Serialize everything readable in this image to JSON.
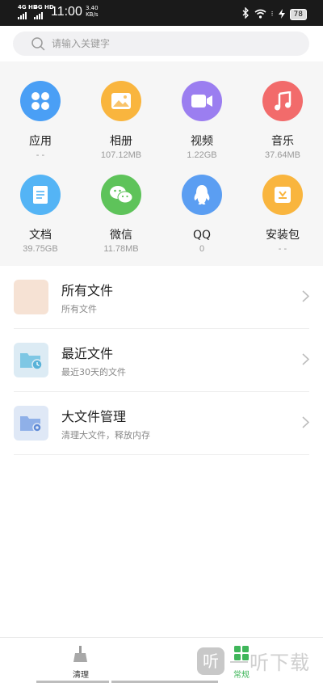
{
  "status_bar": {
    "signal1": "4G HD",
    "signal2": "4G HD",
    "time": "11:00",
    "speed_value": "3.40",
    "speed_unit": "KB/s",
    "battery": "78"
  },
  "search": {
    "placeholder": "请输入关键字"
  },
  "categories": [
    {
      "name": "应用",
      "size": "- -",
      "color": "#4a9ff5",
      "icon": "app-grid-icon"
    },
    {
      "name": "相册",
      "size": "107.12MB",
      "color": "#f9b53e",
      "icon": "photo-icon"
    },
    {
      "name": "视频",
      "size": "1.22GB",
      "color": "#9b7ef0",
      "icon": "video-camera-icon"
    },
    {
      "name": "音乐",
      "size": "37.64MB",
      "color": "#f26b6b",
      "icon": "music-note-icon"
    },
    {
      "name": "文档",
      "size": "39.75GB",
      "color": "#54b4f5",
      "icon": "document-icon"
    },
    {
      "name": "微信",
      "size": "11.78MB",
      "color": "#5ec35a",
      "icon": "wechat-icon"
    },
    {
      "name": "QQ",
      "size": "0",
      "color": "#5b9ef2",
      "icon": "qq-penguin-icon"
    },
    {
      "name": "安装包",
      "size": "- -",
      "color": "#f9b53e",
      "icon": "package-icon"
    }
  ],
  "file_list": [
    {
      "title": "所有文件",
      "subtitle": "所有文件",
      "icon": "all-files-icon"
    },
    {
      "title": "最近文件",
      "subtitle": "最近30天的文件",
      "icon": "recent-files-icon"
    },
    {
      "title": "大文件管理",
      "subtitle": "清理大文件，释放内存",
      "icon": "large-files-icon"
    }
  ],
  "bottom_nav": {
    "clean_label": "清理",
    "general_label": "常规",
    "active_color": "#3fb65a"
  },
  "watermark": {
    "logo": "听",
    "text": "一听下载"
  }
}
